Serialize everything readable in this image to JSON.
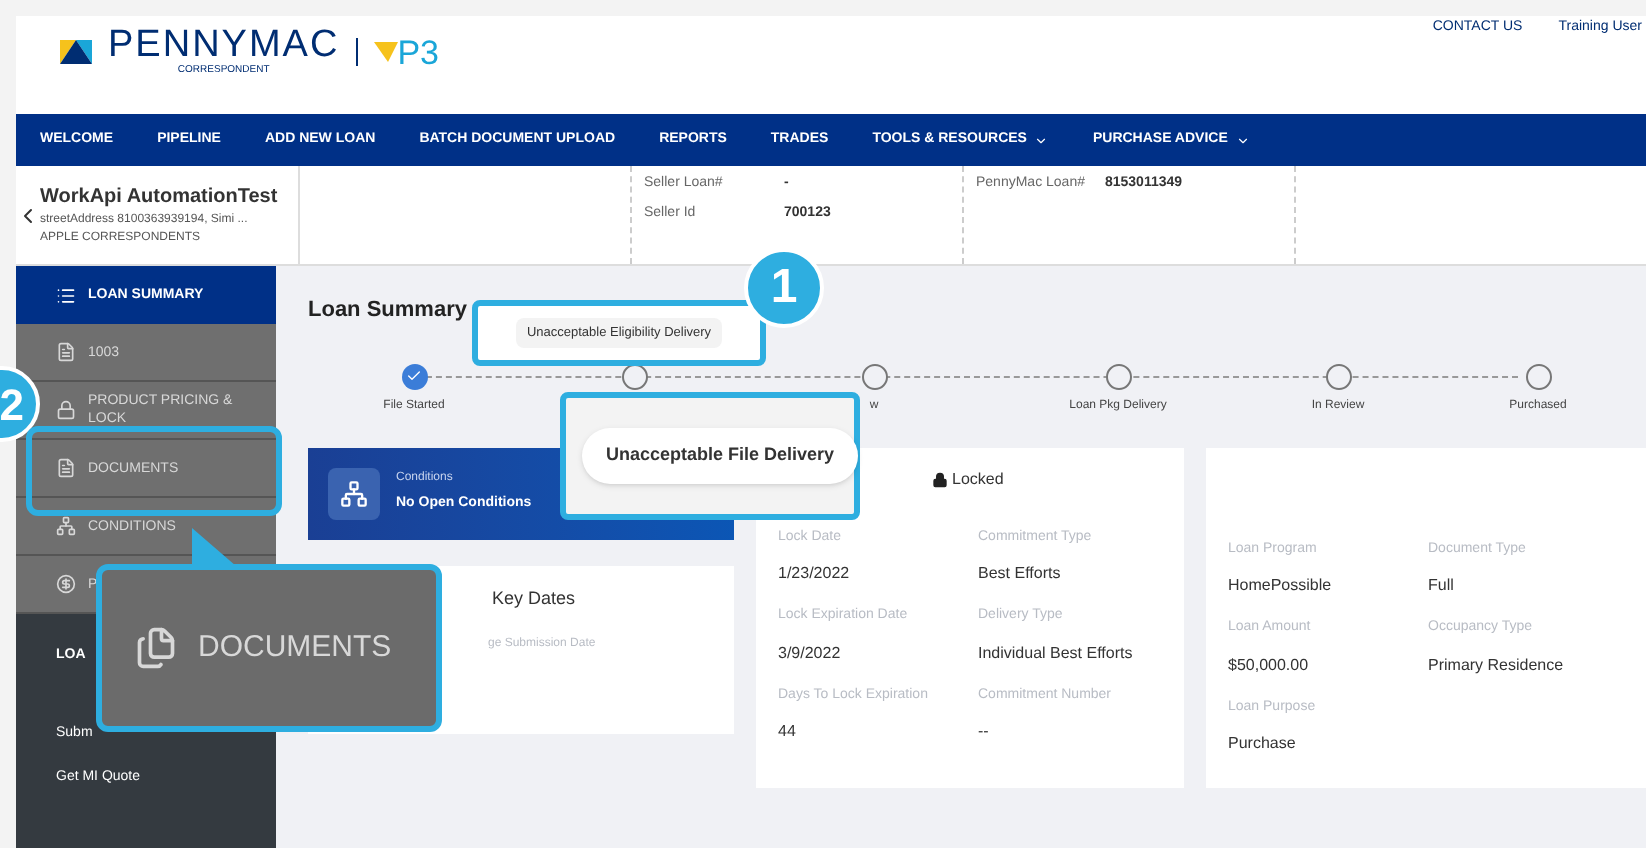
{
  "header": {
    "brand": "PENNYMAC",
    "tagline": "CORRESPONDENT",
    "product": "P3",
    "links": [
      "CONTACT US",
      "Training User"
    ]
  },
  "nav": [
    {
      "label": "WELCOME",
      "dropdown": false
    },
    {
      "label": "PIPELINE",
      "dropdown": false
    },
    {
      "label": "ADD NEW LOAN",
      "dropdown": false
    },
    {
      "label": "BATCH DOCUMENT UPLOAD",
      "dropdown": false
    },
    {
      "label": "REPORTS",
      "dropdown": false
    },
    {
      "label": "TRADES",
      "dropdown": false
    },
    {
      "label": "TOOLS & RESOURCES",
      "dropdown": true
    },
    {
      "label": "PURCHASE ADVICE",
      "dropdown": true
    }
  ],
  "loan_header": {
    "name": "WorkApi AutomationTest",
    "address": "streetAddress 8100363939194, Simi ...",
    "company": "APPLE CORRESPONDENTS",
    "fields": [
      {
        "label": "Seller Loan#",
        "value": "-"
      },
      {
        "label": "Seller Id",
        "value": "700123"
      },
      {
        "label": "PennyMac Loan#",
        "value": "8153011349"
      }
    ]
  },
  "sidebar": {
    "items": [
      {
        "label": "LOAN SUMMARY",
        "kind": "list",
        "selected": true
      },
      {
        "label": "1003",
        "kind": "form",
        "selected": false
      },
      {
        "label": "PRODUCT PRICING & LOCK",
        "kind": "lock",
        "selected": false
      },
      {
        "label": "DOCUMENTS",
        "kind": "document",
        "selected": false
      },
      {
        "label": "CONDITIONS",
        "kind": "conditions",
        "selected": false
      },
      {
        "label": "P",
        "kind": "dollar",
        "selected": false
      }
    ],
    "section": "LOA",
    "links": [
      "Subm",
      "Get MI Quote"
    ]
  },
  "main": {
    "title": "Loan Summary",
    "steps": [
      {
        "label": "File Started",
        "done": true
      },
      {
        "done": false
      },
      {
        "label": "w",
        "done": false
      },
      {
        "label": "Loan Pkg Delivery",
        "done": false
      },
      {
        "label": "In Review",
        "done": false
      },
      {
        "label": "Purchased",
        "done": false
      }
    ],
    "conditions": {
      "label": "Conditions",
      "value": "No Open Conditions"
    },
    "key_dates": {
      "title": "Key Dates",
      "field": "ge Submission Date"
    },
    "lock": {
      "status": "Locked",
      "fields": [
        {
          "label": "Lock Date",
          "value": "1/23/2022"
        },
        {
          "label": "Commitment Type",
          "value": "Best Efforts"
        },
        {
          "label": "Lock Expiration Date",
          "value": "3/9/2022"
        },
        {
          "label": "Delivery Type",
          "value": "Individual Best Efforts"
        },
        {
          "label": "Days To Lock Expiration",
          "value": "44"
        },
        {
          "label": "Commitment Number",
          "value": "--"
        }
      ]
    },
    "loan": {
      "fields": [
        {
          "label": "Loan Program",
          "value": "HomePossible"
        },
        {
          "label": "Document Type",
          "value": "Full"
        },
        {
          "label": "Loan Amount",
          "value": "$50,000.00"
        },
        {
          "label": "Occupancy Type",
          "value": "Primary Residence"
        },
        {
          "label": "Loan Purpose",
          "value": "Purchase"
        }
      ]
    }
  },
  "callouts": [
    {
      "number": "1",
      "tooltip": "Unacceptable Eligibility Delivery",
      "popup": "Unacceptable File Delivery"
    },
    {
      "number": "2",
      "zoom_label": "DOCUMENTS"
    }
  ]
}
